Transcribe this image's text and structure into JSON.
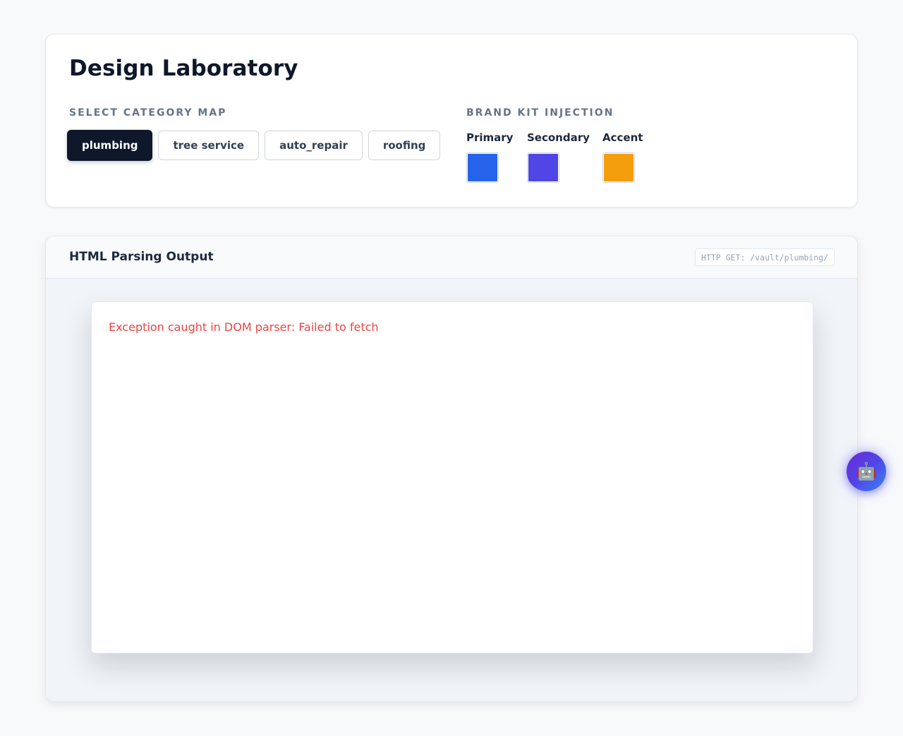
{
  "header": {
    "title": "Design Laboratory",
    "category_label": "SELECT CATEGORY MAP",
    "brand_label": "BRAND KIT INJECTION"
  },
  "categories": [
    {
      "label": "plumbing",
      "active": true
    },
    {
      "label": "tree service",
      "active": false
    },
    {
      "label": "auto_repair",
      "active": false
    },
    {
      "label": "roofing",
      "active": false
    }
  ],
  "brand_kit": [
    {
      "label": "Primary",
      "color": "#2563eb"
    },
    {
      "label": "Secondary",
      "color": "#4f46e5"
    },
    {
      "label": "Accent",
      "color": "#f59e0b"
    }
  ],
  "output": {
    "title": "HTML Parsing Output",
    "endpoint": "HTTP GET: /vault/plumbing/",
    "error": "Exception caught in DOM parser: Failed to fetch"
  },
  "assistant": {
    "icon": "robot-icon",
    "glyph": "🤖"
  }
}
